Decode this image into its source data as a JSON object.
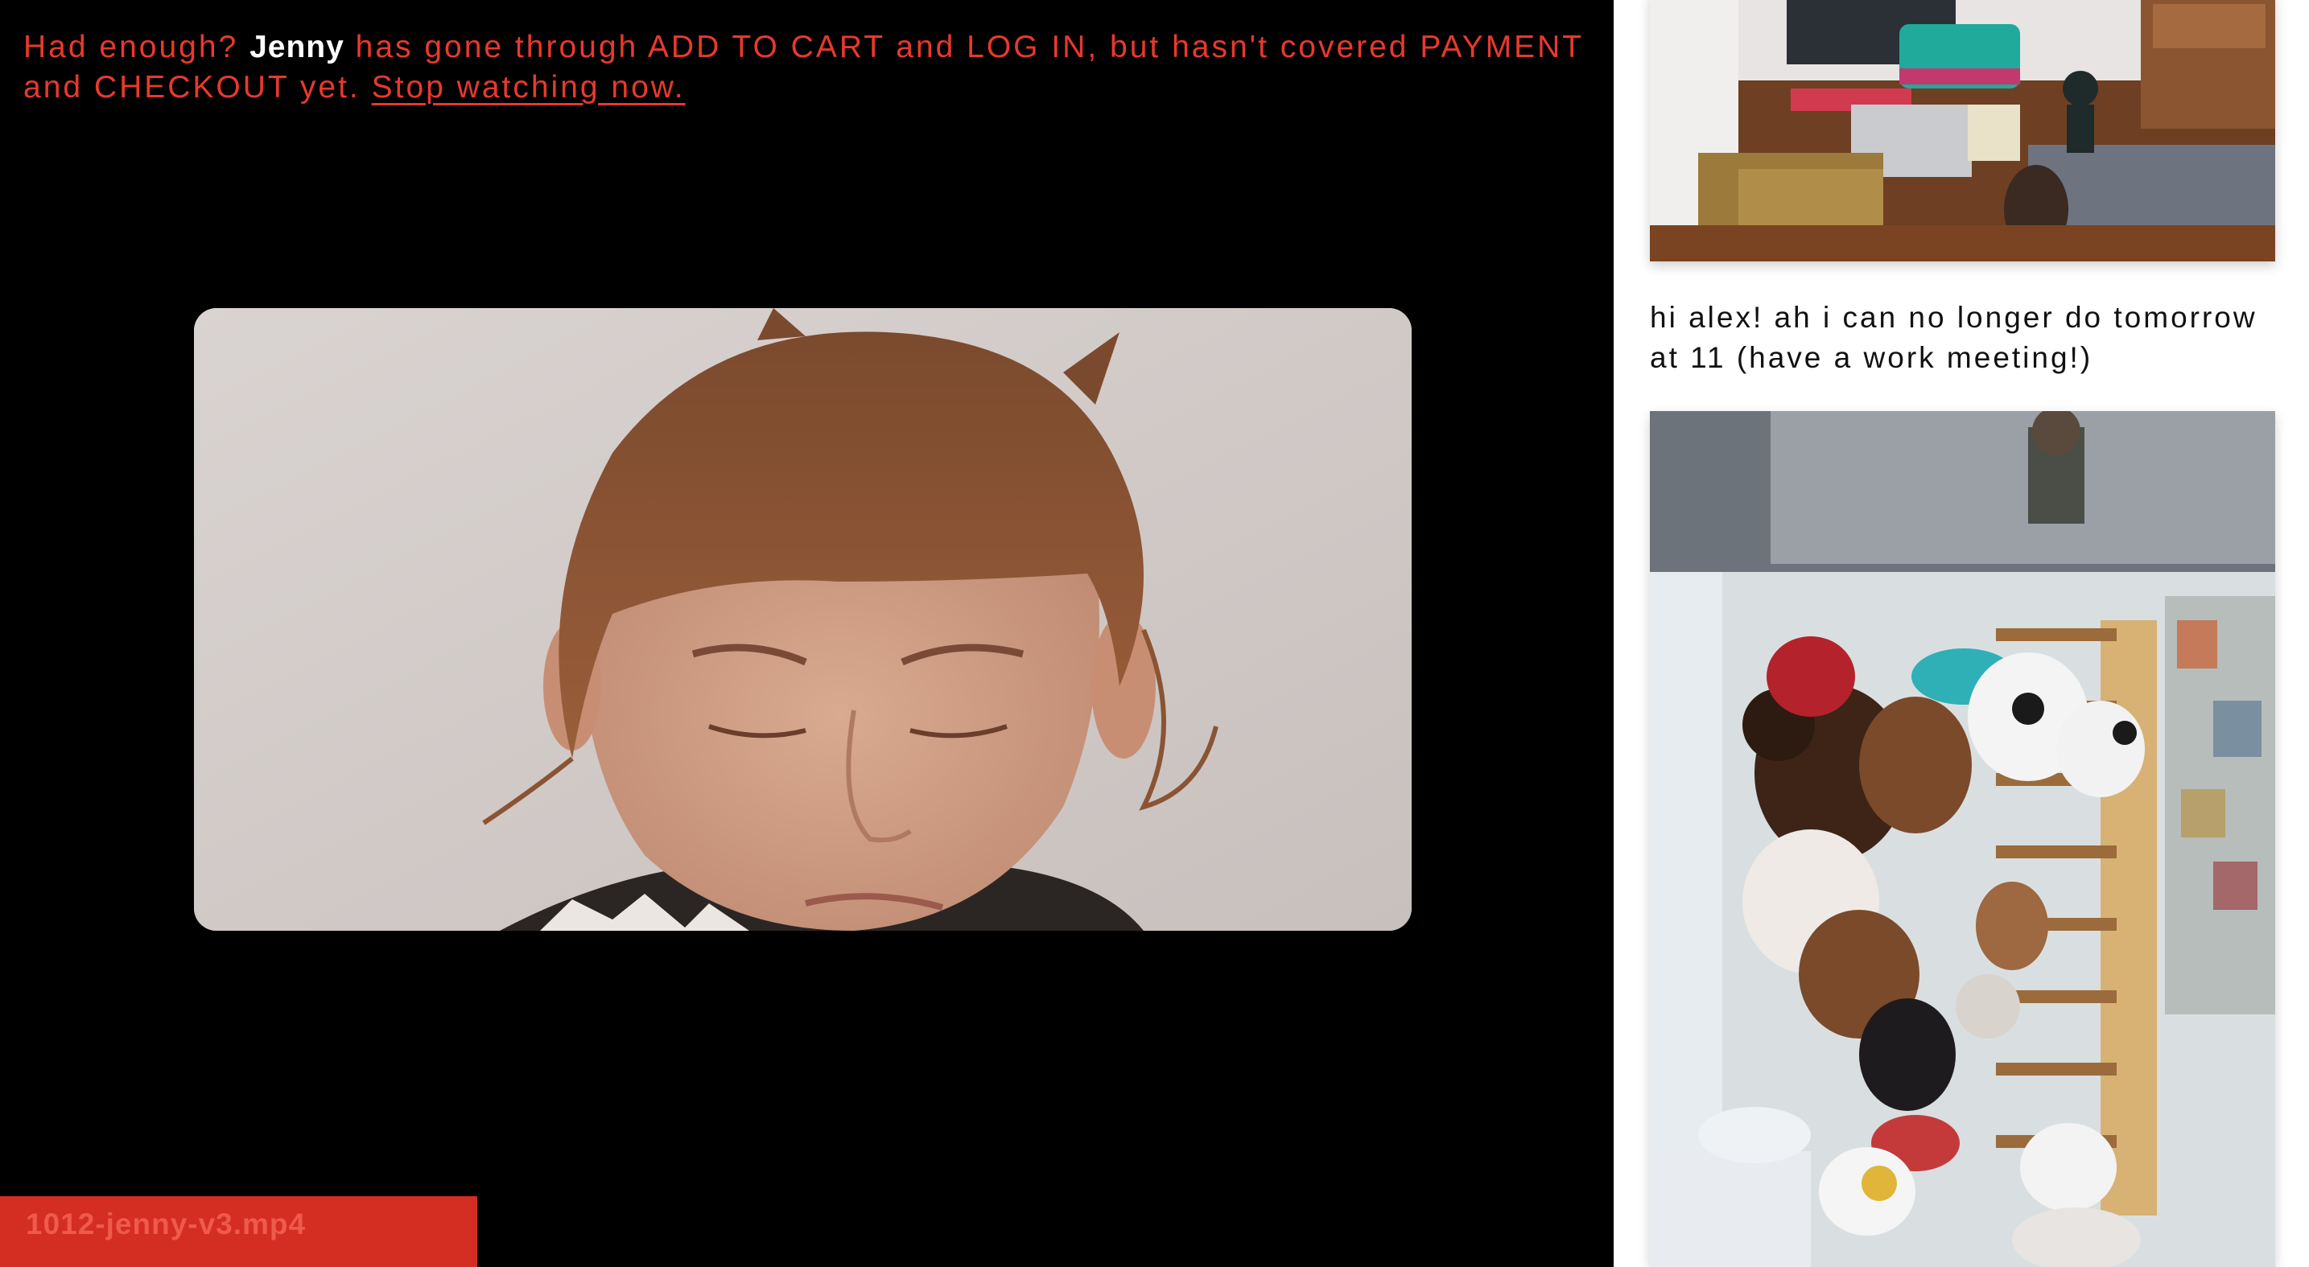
{
  "banner": {
    "lead": "Had enough?",
    "name": "Jenny",
    "body": "has gone through ADD TO CART and LOG IN, but hasn't covered PAYMENT and CHECKOUT yet.",
    "link": "Stop watching now."
  },
  "video": {
    "filename": "1012-jenny-v3.mp4"
  },
  "feed": {
    "note": "hi alex! ah i can no longer do tomorrow at 11 (have a work meeting!)"
  },
  "colors": {
    "accent": "#e8392d",
    "label_bg": "#d42d21",
    "panel_bg": "#000000"
  }
}
